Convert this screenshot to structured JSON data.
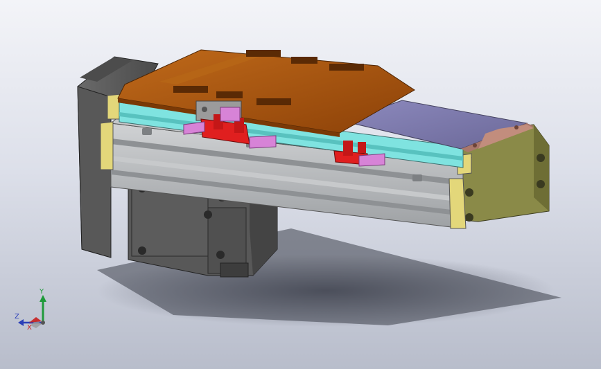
{
  "viewport": {
    "background_top": "#f3f4f8",
    "background_bottom": "#b8bdcb"
  },
  "model": {
    "colors": {
      "carriage": "#a8550e",
      "base_rail": "#b4b6b8",
      "guide_rail": "#7fe3e0",
      "end_cap": "#e3d77a",
      "motor": "#5e5e5e",
      "sensor": "#e01f1f",
      "flag": "#d783d7",
      "cover_plate": "#7a77a8",
      "end_plate": "#8a8a48"
    }
  },
  "triad": {
    "x_label": "X",
    "y_label": "Y",
    "z_label": "Z",
    "x_color": "#c81e1e",
    "y_color": "#1f9a3a",
    "z_color": "#2b3fb8"
  }
}
